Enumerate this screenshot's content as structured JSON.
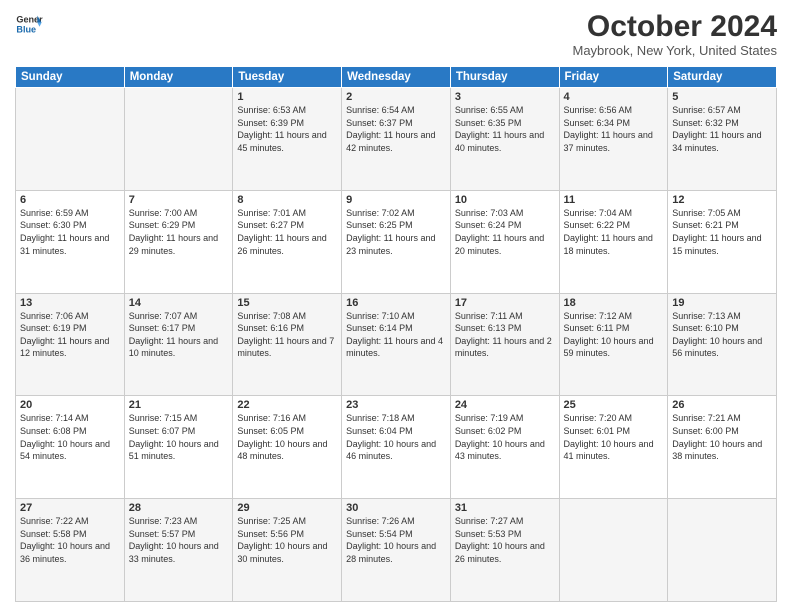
{
  "header": {
    "logo_line1": "General",
    "logo_line2": "Blue",
    "month": "October 2024",
    "location": "Maybrook, New York, United States"
  },
  "days_of_week": [
    "Sunday",
    "Monday",
    "Tuesday",
    "Wednesday",
    "Thursday",
    "Friday",
    "Saturday"
  ],
  "weeks": [
    [
      {
        "num": "",
        "sunrise": "",
        "sunset": "",
        "daylight": ""
      },
      {
        "num": "",
        "sunrise": "",
        "sunset": "",
        "daylight": ""
      },
      {
        "num": "1",
        "sunrise": "Sunrise: 6:53 AM",
        "sunset": "Sunset: 6:39 PM",
        "daylight": "Daylight: 11 hours and 45 minutes."
      },
      {
        "num": "2",
        "sunrise": "Sunrise: 6:54 AM",
        "sunset": "Sunset: 6:37 PM",
        "daylight": "Daylight: 11 hours and 42 minutes."
      },
      {
        "num": "3",
        "sunrise": "Sunrise: 6:55 AM",
        "sunset": "Sunset: 6:35 PM",
        "daylight": "Daylight: 11 hours and 40 minutes."
      },
      {
        "num": "4",
        "sunrise": "Sunrise: 6:56 AM",
        "sunset": "Sunset: 6:34 PM",
        "daylight": "Daylight: 11 hours and 37 minutes."
      },
      {
        "num": "5",
        "sunrise": "Sunrise: 6:57 AM",
        "sunset": "Sunset: 6:32 PM",
        "daylight": "Daylight: 11 hours and 34 minutes."
      }
    ],
    [
      {
        "num": "6",
        "sunrise": "Sunrise: 6:59 AM",
        "sunset": "Sunset: 6:30 PM",
        "daylight": "Daylight: 11 hours and 31 minutes."
      },
      {
        "num": "7",
        "sunrise": "Sunrise: 7:00 AM",
        "sunset": "Sunset: 6:29 PM",
        "daylight": "Daylight: 11 hours and 29 minutes."
      },
      {
        "num": "8",
        "sunrise": "Sunrise: 7:01 AM",
        "sunset": "Sunset: 6:27 PM",
        "daylight": "Daylight: 11 hours and 26 minutes."
      },
      {
        "num": "9",
        "sunrise": "Sunrise: 7:02 AM",
        "sunset": "Sunset: 6:25 PM",
        "daylight": "Daylight: 11 hours and 23 minutes."
      },
      {
        "num": "10",
        "sunrise": "Sunrise: 7:03 AM",
        "sunset": "Sunset: 6:24 PM",
        "daylight": "Daylight: 11 hours and 20 minutes."
      },
      {
        "num": "11",
        "sunrise": "Sunrise: 7:04 AM",
        "sunset": "Sunset: 6:22 PM",
        "daylight": "Daylight: 11 hours and 18 minutes."
      },
      {
        "num": "12",
        "sunrise": "Sunrise: 7:05 AM",
        "sunset": "Sunset: 6:21 PM",
        "daylight": "Daylight: 11 hours and 15 minutes."
      }
    ],
    [
      {
        "num": "13",
        "sunrise": "Sunrise: 7:06 AM",
        "sunset": "Sunset: 6:19 PM",
        "daylight": "Daylight: 11 hours and 12 minutes."
      },
      {
        "num": "14",
        "sunrise": "Sunrise: 7:07 AM",
        "sunset": "Sunset: 6:17 PM",
        "daylight": "Daylight: 11 hours and 10 minutes."
      },
      {
        "num": "15",
        "sunrise": "Sunrise: 7:08 AM",
        "sunset": "Sunset: 6:16 PM",
        "daylight": "Daylight: 11 hours and 7 minutes."
      },
      {
        "num": "16",
        "sunrise": "Sunrise: 7:10 AM",
        "sunset": "Sunset: 6:14 PM",
        "daylight": "Daylight: 11 hours and 4 minutes."
      },
      {
        "num": "17",
        "sunrise": "Sunrise: 7:11 AM",
        "sunset": "Sunset: 6:13 PM",
        "daylight": "Daylight: 11 hours and 2 minutes."
      },
      {
        "num": "18",
        "sunrise": "Sunrise: 7:12 AM",
        "sunset": "Sunset: 6:11 PM",
        "daylight": "Daylight: 10 hours and 59 minutes."
      },
      {
        "num": "19",
        "sunrise": "Sunrise: 7:13 AM",
        "sunset": "Sunset: 6:10 PM",
        "daylight": "Daylight: 10 hours and 56 minutes."
      }
    ],
    [
      {
        "num": "20",
        "sunrise": "Sunrise: 7:14 AM",
        "sunset": "Sunset: 6:08 PM",
        "daylight": "Daylight: 10 hours and 54 minutes."
      },
      {
        "num": "21",
        "sunrise": "Sunrise: 7:15 AM",
        "sunset": "Sunset: 6:07 PM",
        "daylight": "Daylight: 10 hours and 51 minutes."
      },
      {
        "num": "22",
        "sunrise": "Sunrise: 7:16 AM",
        "sunset": "Sunset: 6:05 PM",
        "daylight": "Daylight: 10 hours and 48 minutes."
      },
      {
        "num": "23",
        "sunrise": "Sunrise: 7:18 AM",
        "sunset": "Sunset: 6:04 PM",
        "daylight": "Daylight: 10 hours and 46 minutes."
      },
      {
        "num": "24",
        "sunrise": "Sunrise: 7:19 AM",
        "sunset": "Sunset: 6:02 PM",
        "daylight": "Daylight: 10 hours and 43 minutes."
      },
      {
        "num": "25",
        "sunrise": "Sunrise: 7:20 AM",
        "sunset": "Sunset: 6:01 PM",
        "daylight": "Daylight: 10 hours and 41 minutes."
      },
      {
        "num": "26",
        "sunrise": "Sunrise: 7:21 AM",
        "sunset": "Sunset: 6:00 PM",
        "daylight": "Daylight: 10 hours and 38 minutes."
      }
    ],
    [
      {
        "num": "27",
        "sunrise": "Sunrise: 7:22 AM",
        "sunset": "Sunset: 5:58 PM",
        "daylight": "Daylight: 10 hours and 36 minutes."
      },
      {
        "num": "28",
        "sunrise": "Sunrise: 7:23 AM",
        "sunset": "Sunset: 5:57 PM",
        "daylight": "Daylight: 10 hours and 33 minutes."
      },
      {
        "num": "29",
        "sunrise": "Sunrise: 7:25 AM",
        "sunset": "Sunset: 5:56 PM",
        "daylight": "Daylight: 10 hours and 30 minutes."
      },
      {
        "num": "30",
        "sunrise": "Sunrise: 7:26 AM",
        "sunset": "Sunset: 5:54 PM",
        "daylight": "Daylight: 10 hours and 28 minutes."
      },
      {
        "num": "31",
        "sunrise": "Sunrise: 7:27 AM",
        "sunset": "Sunset: 5:53 PM",
        "daylight": "Daylight: 10 hours and 26 minutes."
      },
      {
        "num": "",
        "sunrise": "",
        "sunset": "",
        "daylight": ""
      },
      {
        "num": "",
        "sunrise": "",
        "sunset": "",
        "daylight": ""
      }
    ]
  ]
}
